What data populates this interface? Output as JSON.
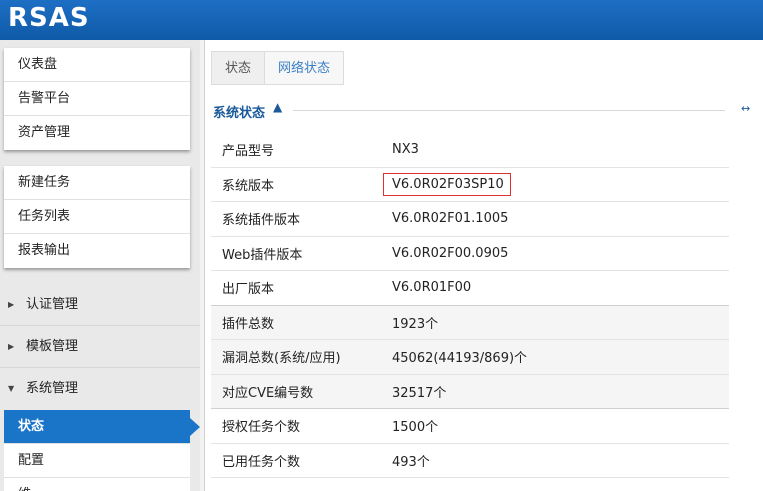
{
  "app": {
    "logo": "RSAS"
  },
  "sidebar": {
    "group1": [
      "仪表盘",
      "告警平台",
      "资产管理"
    ],
    "group2": [
      "新建任务",
      "任务列表",
      "报表输出"
    ],
    "sections": [
      "认证管理",
      "模板管理",
      "系统管理"
    ],
    "sub_items": [
      "状态",
      "配置",
      "维"
    ],
    "active_sub": "状态"
  },
  "tabs": [
    "状态",
    "网络状态"
  ],
  "section": {
    "title": "系统状态",
    "chevron": "▲",
    "tool_icon": "↔"
  },
  "info_rows": [
    {
      "label": "产品型号",
      "value": "NX3"
    },
    {
      "label": "系统版本",
      "value": "V6.0R02F03SP10"
    },
    {
      "label": "系统插件版本",
      "value": "V6.0R02F01.1005"
    },
    {
      "label": "Web插件版本",
      "value": "V6.0R02F00.0905"
    },
    {
      "label": "出厂版本",
      "value": "V6.0R01F00"
    },
    {
      "label": "插件总数",
      "value": "1923个"
    },
    {
      "label": "漏洞总数(系统/应用)",
      "value": "45062(44193/869)个"
    },
    {
      "label": "对应CVE编号数",
      "value": "32517个"
    },
    {
      "label": "授权任务个数",
      "value": "1500个"
    },
    {
      "label": "已用任务个数",
      "value": "493个"
    }
  ],
  "colors": {
    "header": "#1a6ec0",
    "accent": "#1a75c9",
    "highlight_border": "#e03030"
  }
}
